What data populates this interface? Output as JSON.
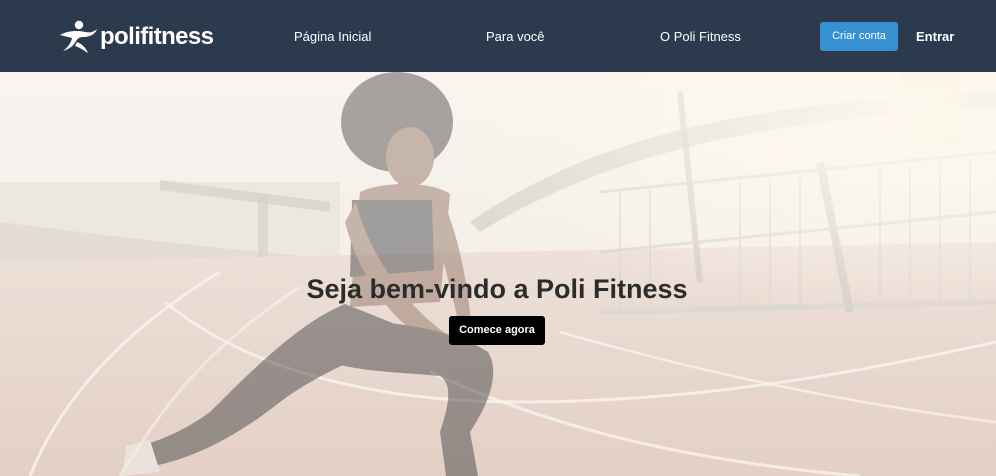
{
  "brand": {
    "name": "polifitness",
    "logo_icon": "runner-icon"
  },
  "nav": {
    "links": [
      "Página Inicial",
      "Para você",
      "O Poli Fitness"
    ],
    "signup_label": "Criar conta",
    "login_label": "Entrar"
  },
  "hero": {
    "title": "Seja bem-vindo a Poli Fitness",
    "cta_label": "Comece agora",
    "image_subject": "woman-stretching-on-running-track"
  },
  "colors": {
    "navbar_bg": "#2c3a4d",
    "signup_button": "#3690d2",
    "cta_button": "#000000",
    "title_text": "#2c2c2c"
  }
}
